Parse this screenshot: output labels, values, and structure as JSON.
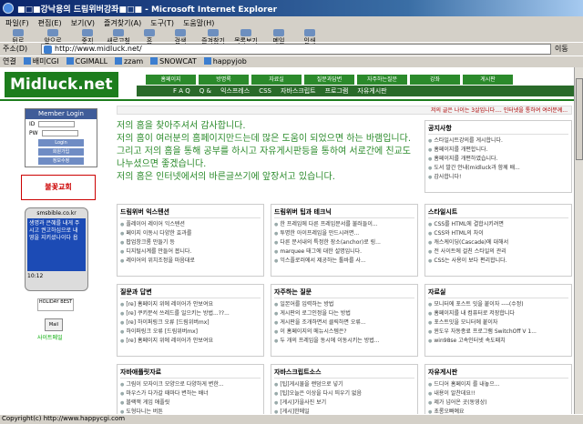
{
  "window": {
    "title": "■□■강낙용의 드림위버강좌■□■ - Microsoft Internet Explorer"
  },
  "menu": [
    "파일(F)",
    "편집(E)",
    "보기(V)",
    "즐겨찾기(A)",
    "도구(T)",
    "도움말(H)"
  ],
  "toolbar": [
    "뒤로",
    "앞으로",
    "중지",
    "새로고침",
    "홈",
    "검색",
    "즐겨찾기",
    "목록보기",
    "메일",
    "인쇄"
  ],
  "address": {
    "label": "주소(D)",
    "url": "http://www.midluck.net/",
    "go": "이동"
  },
  "links": {
    "label": "연결",
    "items": [
      "배미CGI",
      "CGIMALL",
      "zzam",
      "SNOWCAT",
      "happyjob"
    ]
  },
  "site": {
    "logo": "Midluck.net",
    "nav1": [
      "홈페이지",
      "방명록",
      "자료실",
      "질문과답변",
      "자주하는질문",
      "강좌",
      "게시판"
    ],
    "nav2": [
      "F A Q",
      "Q &",
      "익스프레스",
      "CSS",
      "자바스크립트",
      "프로그램",
      "자유게시판"
    ],
    "login": {
      "title": "Member Login",
      "id_label": "ID",
      "pw_label": "PW",
      "buttons": [
        "Login",
        "회원가입",
        "정보수정"
      ]
    },
    "church": "불꽃교회",
    "phone": {
      "site": "smsbible.co.kr",
      "msg": "생명과 은혜를 내게 주시고 권고하심으로 내 영을 지키셨나이다 욥",
      "time": "10:12"
    },
    "badge2": "HOLIDAY BEST",
    "mail_label": "Mail",
    "mail_text": "사이트메일",
    "marquee": "저의 글은 나이는 3살입니다.... 인터넷을 통하여 여러분께...",
    "greeting": [
      "저의 홈을 찾아주셔서 감사합니다.",
      "저의 홈이 여러분의 홈페이지만드는데 많은 도움이 되었으면 하는 바램입니다.",
      "그리고 저의 홈을 통해 공부를 하시고 자유게시판등을 통하여 서로간에 친교도 나누셨으면 좋겠습니다.",
      "저의 홈은 인터넷에서의 바른글쓰기에 앞장서고 있습니다."
    ],
    "notice": {
      "title": "공지사항",
      "items": [
        "스타일시트강의를 게시합니다.",
        "홈페이지를 개편합니다.",
        "홈페이지를 개편하였습니다.",
        "도서 발간 안내(midluck과 함께 배...",
        "감사합니다!"
      ]
    },
    "boxes": [
      {
        "title": "드림위버 익스텐션",
        "items": [
          "플레이어 레이어 익스텐션",
          "페이지 이동시 다양한 효과를",
          "팝업창크롬 만들기 등",
          "디지털시계를 만들어 봅니다.",
          "레이어의 위치조정을 마음대로"
        ]
      },
      {
        "title": "드림위버 팁과 테크닉",
        "items": [
          "한 프레임에 다른 프레임문서를 불러들이...",
          "투명한 아이프레임을 만드시려면...",
          "다른 문서내의 특정한 장소(anchor)로 링...",
          "marquee 태그에 대한 설명입니다.",
          "익스플로러에서 제공하는 툴바를 사..."
        ]
      },
      {
        "title": "스타일시트",
        "items": [
          "CSS를 HTML에 결합시키려면",
          "CSS와 HTML의 차이",
          "캐스케이딩(Cascade)에 대해서",
          "전 사이트에 걸친 스타일의 관리",
          "CSS는 사용이 보다 편리합니다."
        ]
      },
      {
        "title": "질문과 답변",
        "items": [
          "[re] 홈페이지 위에 레이어가 안보여요",
          "[re] 쿠키분석 쓰레드를 일으키는 방법...??...",
          "[re] 하이퍼링크 오류 [드림위버mx]",
          "하이퍼링크 오류 [드림위버mx]",
          "[re] 홈페이지 위에 레이어가 안보여요"
        ]
      },
      {
        "title": "자주하는 질문",
        "items": [
          "일본어를 입력하는 방법",
          "게시판의 로그인정을 다는 방법",
          "게시판을 조개하면서 클릭하면 오류...",
          "이 홈페이지의 메뉴시스템은?",
          "두 개의 프레임을 동시에 이동시키는 방법..."
        ]
      },
      {
        "title": "자료실",
        "items": [
          "모니터에 포스트 잇을 붙이자 ----(수정)",
          "홈페이지를 내 컴퓨터로 저장합니다",
          "포스트잇을 모니터에 붙이자",
          "윈도우 자동종료 프로그램 SwitchOff V 1...",
          "win98se 고속인터넷 속도패치"
        ]
      },
      {
        "title": "자바애플릿자료",
        "items": [
          "그림이 모자이크 모양으로 다양하게 변한...",
          "마우스가 다가갈 때마다 변하는 배너",
          "블랙잭 게임 애플릿",
          "도형다니는 버튼",
          "조용한 전자판 게임을 하는 애플릿입니다"
        ]
      },
      {
        "title": "자바스크립트소스",
        "items": [
          "[팁]게시물을 랜덤으로 넣기",
          "[팁]오늘은 이상을 다시 띄우기 없음",
          "[게시]가을사진 보기",
          "[게시]한메일",
          "[게시]한홈오목카이처럼 효과를 만든..."
        ]
      },
      {
        "title": "자유게시판",
        "items": [
          "드디어 홈페이지 를 내놓으...",
          "내용이 알찬데요!!",
          "제가 넘어온 곳(동영상)",
          "초롱오빠예요",
          "감사합니다 안 한번에 감사드립니다."
        ]
      }
    ]
  },
  "status": "Copyright(c) http://www.happycgi.com"
}
